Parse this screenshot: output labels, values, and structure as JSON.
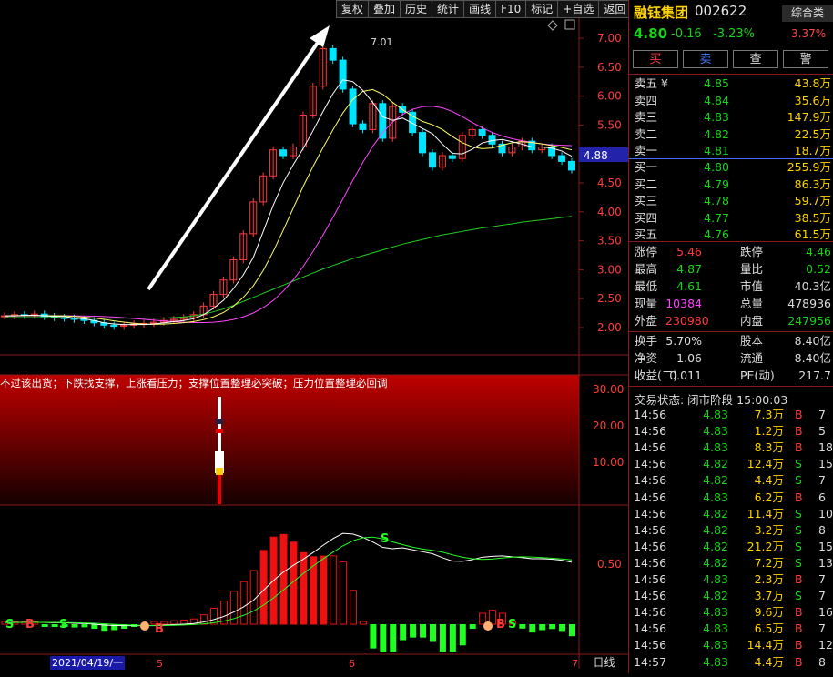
{
  "toolbar": [
    "复权",
    "叠加",
    "历史",
    "统计",
    "画线",
    "F10",
    "标记",
    "+自选",
    "返回"
  ],
  "price_axis": [
    "7.00",
    "6.50",
    "6.00",
    "5.50",
    "5.00",
    "4.50",
    "4.00",
    "3.50",
    "3.00",
    "2.50",
    "2.00"
  ],
  "indicator_axis": [
    "30.00",
    "20.00",
    "10.00"
  ],
  "macd_axis": "0.50",
  "current_price_tag": "4.88",
  "peak_label": "7.01",
  "banner": "不过该出货；下跌找支撑，上涨看压力；支撑位置整理必突破；压力位置整理必回调",
  "date_label": "2021/04/19/一",
  "month_labels": [
    "5",
    "6",
    "7"
  ],
  "period": "日线",
  "signal_labels": [
    "S",
    "B",
    "S",
    "B",
    "S",
    "B",
    "S"
  ],
  "stock": {
    "name": "融钰集团",
    "code": "002622",
    "combo": "综合类",
    "price": "4.80",
    "change": "-0.16",
    "change_pct": "-3.23%",
    "sector_pct": "3.37%"
  },
  "actions": [
    "买",
    "卖",
    "查",
    "警"
  ],
  "asks": [
    {
      "label": "卖五 ¥",
      "price": "4.85",
      "vol": "43.8万"
    },
    {
      "label": "卖四",
      "price": "4.84",
      "vol": "35.6万"
    },
    {
      "label": "卖三",
      "price": "4.83",
      "vol": "147.9万"
    },
    {
      "label": "卖二",
      "price": "4.82",
      "vol": "22.5万"
    },
    {
      "label": "卖一",
      "price": "4.81",
      "vol": "18.7万"
    }
  ],
  "bids": [
    {
      "label": "买一",
      "price": "4.80",
      "vol": "255.9万"
    },
    {
      "label": "买二",
      "price": "4.79",
      "vol": "86.3万"
    },
    {
      "label": "买三",
      "price": "4.78",
      "vol": "59.7万"
    },
    {
      "label": "买四",
      "price": "4.77",
      "vol": "38.5万"
    },
    {
      "label": "买五",
      "price": "4.76",
      "vol": "61.5万"
    }
  ],
  "stats1": [
    {
      "k1": "涨停",
      "v1": "5.46",
      "c1": "red",
      "k2": "跌停",
      "v2": "4.46",
      "c2": "green"
    },
    {
      "k1": "最高",
      "v1": "4.87",
      "c1": "green",
      "k2": "量比",
      "v2": "0.52",
      "c2": "green"
    },
    {
      "k1": "最低",
      "v1": "4.61",
      "c1": "green",
      "k2": "市值",
      "v2": "40.3亿",
      "c2": "white"
    },
    {
      "k1": "现量",
      "v1": "10384",
      "c1": "magenta",
      "k2": "总量",
      "v2": "478936",
      "c2": "white"
    },
    {
      "k1": "外盘",
      "v1": "230980",
      "c1": "red",
      "k2": "内盘",
      "v2": "247956",
      "c2": "green"
    }
  ],
  "stats2": [
    {
      "k1": "换手",
      "v1": "5.70%",
      "c1": "white",
      "k2": "股本",
      "v2": "8.40亿",
      "c2": "white"
    },
    {
      "k1": "净资",
      "v1": "1.06",
      "c1": "white",
      "k2": "流通",
      "v2": "8.40亿",
      "c2": "white"
    },
    {
      "k1": "收益(二)",
      "v1": "0.011",
      "c1": "white",
      "k2": "PE(动)",
      "v2": "217.7",
      "c2": "white"
    }
  ],
  "trade_status": "交易状态: 闭市阶段 15:00:03",
  "trades": [
    {
      "t": "14:56",
      "p": "4.83",
      "pc": "green",
      "v": "7.3万",
      "bs": "B",
      "n": "7"
    },
    {
      "t": "14:56",
      "p": "4.83",
      "pc": "green",
      "v": "1.2万",
      "bs": "B",
      "n": "5"
    },
    {
      "t": "14:56",
      "p": "4.83",
      "pc": "green",
      "v": "8.3万",
      "bs": "B",
      "n": "18"
    },
    {
      "t": "14:56",
      "p": "4.82",
      "pc": "green",
      "v": "12.4万",
      "bs": "S",
      "n": "15"
    },
    {
      "t": "14:56",
      "p": "4.82",
      "pc": "green",
      "v": "4.4万",
      "bs": "S",
      "n": "7"
    },
    {
      "t": "14:56",
      "p": "4.83",
      "pc": "green",
      "v": "6.2万",
      "bs": "B",
      "n": "6"
    },
    {
      "t": "14:56",
      "p": "4.82",
      "pc": "green",
      "v": "11.4万",
      "bs": "S",
      "n": "10"
    },
    {
      "t": "14:56",
      "p": "4.82",
      "pc": "green",
      "v": "3.2万",
      "bs": "S",
      "n": "8"
    },
    {
      "t": "14:56",
      "p": "4.82",
      "pc": "green",
      "v": "21.2万",
      "bs": "S",
      "n": "15"
    },
    {
      "t": "14:56",
      "p": "4.82",
      "pc": "green",
      "v": "7.2万",
      "bs": "S",
      "n": "13"
    },
    {
      "t": "14:56",
      "p": "4.83",
      "pc": "green",
      "v": "2.3万",
      "bs": "B",
      "n": "7"
    },
    {
      "t": "14:56",
      "p": "4.82",
      "pc": "green",
      "v": "3.7万",
      "bs": "S",
      "n": "7"
    },
    {
      "t": "14:56",
      "p": "4.83",
      "pc": "green",
      "v": "9.6万",
      "bs": "B",
      "n": "16"
    },
    {
      "t": "14:56",
      "p": "4.83",
      "pc": "green",
      "v": "6.5万",
      "bs": "B",
      "n": "7"
    },
    {
      "t": "14:56",
      "p": "4.83",
      "pc": "green",
      "v": "14.4万",
      "bs": "B",
      "n": "12"
    },
    {
      "t": "14:57",
      "p": "4.83",
      "pc": "green",
      "v": "4.4万",
      "bs": "B",
      "n": "8"
    }
  ],
  "colors": {
    "up": "#ff3b3b",
    "down": "#19d219",
    "candle_down": "#00e5ff",
    "ma5": "#ffffff",
    "ma10": "#ffff66",
    "ma20": "#ff44ff",
    "ma60": "#22cc22",
    "axis": "#8a1a1a"
  },
  "chart_data": {
    "type": "candlestick",
    "price_ylim": [
      1.7,
      7.3
    ],
    "closes": [
      2.28,
      2.3,
      2.29,
      2.31,
      2.27,
      2.25,
      2.24,
      2.22,
      2.2,
      2.16,
      2.12,
      2.1,
      2.12,
      2.14,
      2.15,
      2.17,
      2.2,
      2.22,
      2.25,
      2.3,
      2.45,
      2.65,
      2.9,
      3.25,
      3.7,
      4.25,
      4.7,
      5.15,
      5.05,
      5.2,
      5.75,
      6.25,
      6.9,
      6.7,
      6.2,
      5.6,
      5.5,
      5.95,
      5.35,
      5.9,
      5.8,
      5.45,
      5.1,
      4.85,
      5.05,
      5.0,
      5.4,
      5.5,
      5.4,
      5.25,
      5.1,
      5.2,
      5.3,
      5.15,
      5.2,
      5.05,
      4.95,
      4.8
    ],
    "ma5": [
      2.28,
      2.28,
      2.29,
      2.29,
      2.28,
      2.27,
      2.27,
      2.24,
      2.23,
      2.2,
      2.16,
      2.14,
      2.13,
      2.13,
      2.13,
      2.14,
      2.16,
      2.18,
      2.2,
      2.23,
      2.3,
      2.41,
      2.55,
      2.75,
      2.99,
      3.29,
      3.74,
      4.19,
      4.58,
      4.89,
      5.17,
      5.48,
      5.81,
      6.12,
      6.36,
      6.33,
      6.18,
      5.97,
      5.72,
      5.66,
      5.7,
      5.61,
      5.52,
      5.43,
      5.25,
      5.09,
      5.08,
      5.16,
      5.27,
      5.31,
      5.33,
      5.29,
      5.25,
      5.2,
      5.2,
      5.18,
      5.13,
      5.04
    ],
    "ma60": [
      2.25,
      2.25,
      2.25,
      2.25,
      2.25,
      2.25,
      2.25,
      2.24,
      2.24,
      2.24,
      2.24,
      2.24,
      2.24,
      2.24,
      2.24,
      2.24,
      2.24,
      2.25,
      2.26,
      2.28,
      2.31,
      2.35,
      2.4,
      2.46,
      2.53,
      2.6,
      2.67,
      2.74,
      2.81,
      2.88,
      2.95,
      3.02,
      3.09,
      3.15,
      3.21,
      3.27,
      3.32,
      3.37,
      3.42,
      3.47,
      3.52,
      3.56,
      3.6,
      3.64,
      3.68,
      3.71,
      3.74,
      3.77,
      3.8,
      3.82,
      3.85,
      3.87,
      3.9,
      3.92,
      3.94,
      3.96,
      3.98,
      4.0
    ]
  }
}
